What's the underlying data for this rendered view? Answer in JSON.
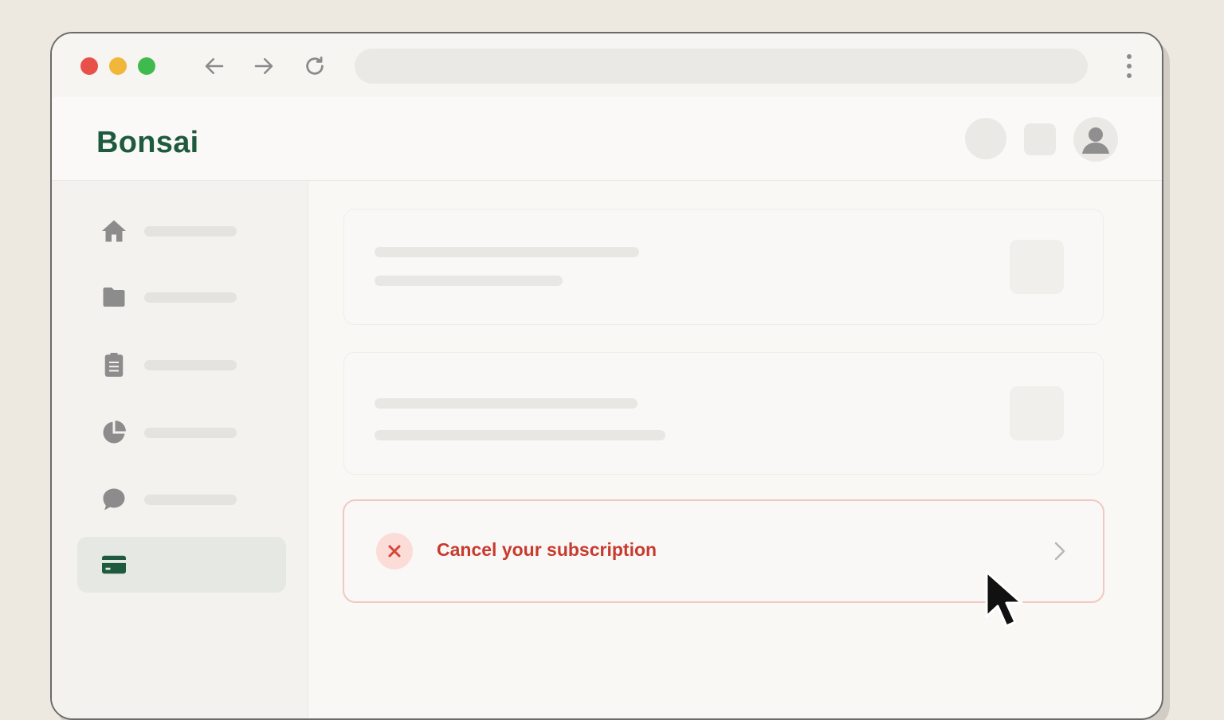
{
  "app": {
    "name": "Bonsai",
    "brand_color": "#1e5a3e"
  },
  "browser": {
    "window_controls": [
      "close",
      "minimize",
      "maximize"
    ],
    "nav_icons": [
      "back-arrow-icon",
      "forward-arrow-icon",
      "reload-icon",
      "more-vertical-icon"
    ],
    "url": ""
  },
  "header": {
    "icons": [
      "placeholder-circle",
      "placeholder-square",
      "user-avatar-icon"
    ]
  },
  "sidebar": {
    "items": [
      {
        "icon": "home-icon",
        "label": "",
        "active": false
      },
      {
        "icon": "folder-icon",
        "label": "",
        "active": false
      },
      {
        "icon": "clipboard-icon",
        "label": "",
        "active": false
      },
      {
        "icon": "pie-chart-icon",
        "label": "",
        "active": false
      },
      {
        "icon": "chat-bubble-icon",
        "label": "",
        "active": false
      },
      {
        "icon": "credit-card-icon",
        "label": "",
        "active": true
      }
    ]
  },
  "main": {
    "cancel_action": {
      "label": "Cancel your subscription",
      "icon": "x-icon",
      "trailing_icon": "chevron-right-icon",
      "color": "#c73b2e"
    }
  }
}
